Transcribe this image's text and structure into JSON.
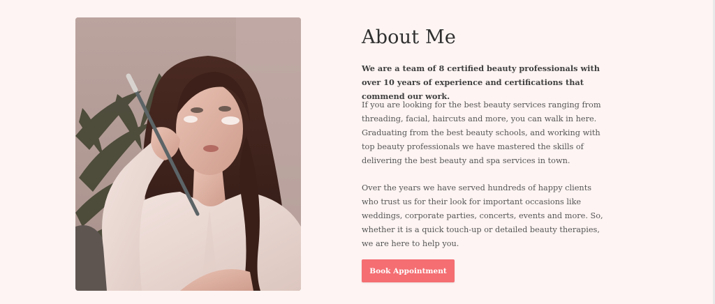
{
  "about": {
    "title": "About Me",
    "lead": "We are a team of 8 certified beauty professionals with over 10 years of experience and certifications that commend our work.",
    "paragraph1": "If you are looking for the best beauty services ranging from threading, facial, haircuts and more, you can walk in here. Graduating from the best beauty schools, and working with top beauty professionals we have mastered the skills of delivering the best beauty and spa services in town.",
    "paragraph2": "Over the years we have served hundreds of happy clients who trust us for their look for important occasions like weddings, corporate parties, concerts, events and more. So, whether it is a quick touch-up or detailed beauty therapies, we are here to help you.",
    "button_label": "Book Appointment"
  },
  "colors": {
    "page_background": "#fdf4f3",
    "button_accent": "#f46e72",
    "heading_text": "#2f2f2f"
  },
  "photo": {
    "icon": "portrait-photo"
  }
}
